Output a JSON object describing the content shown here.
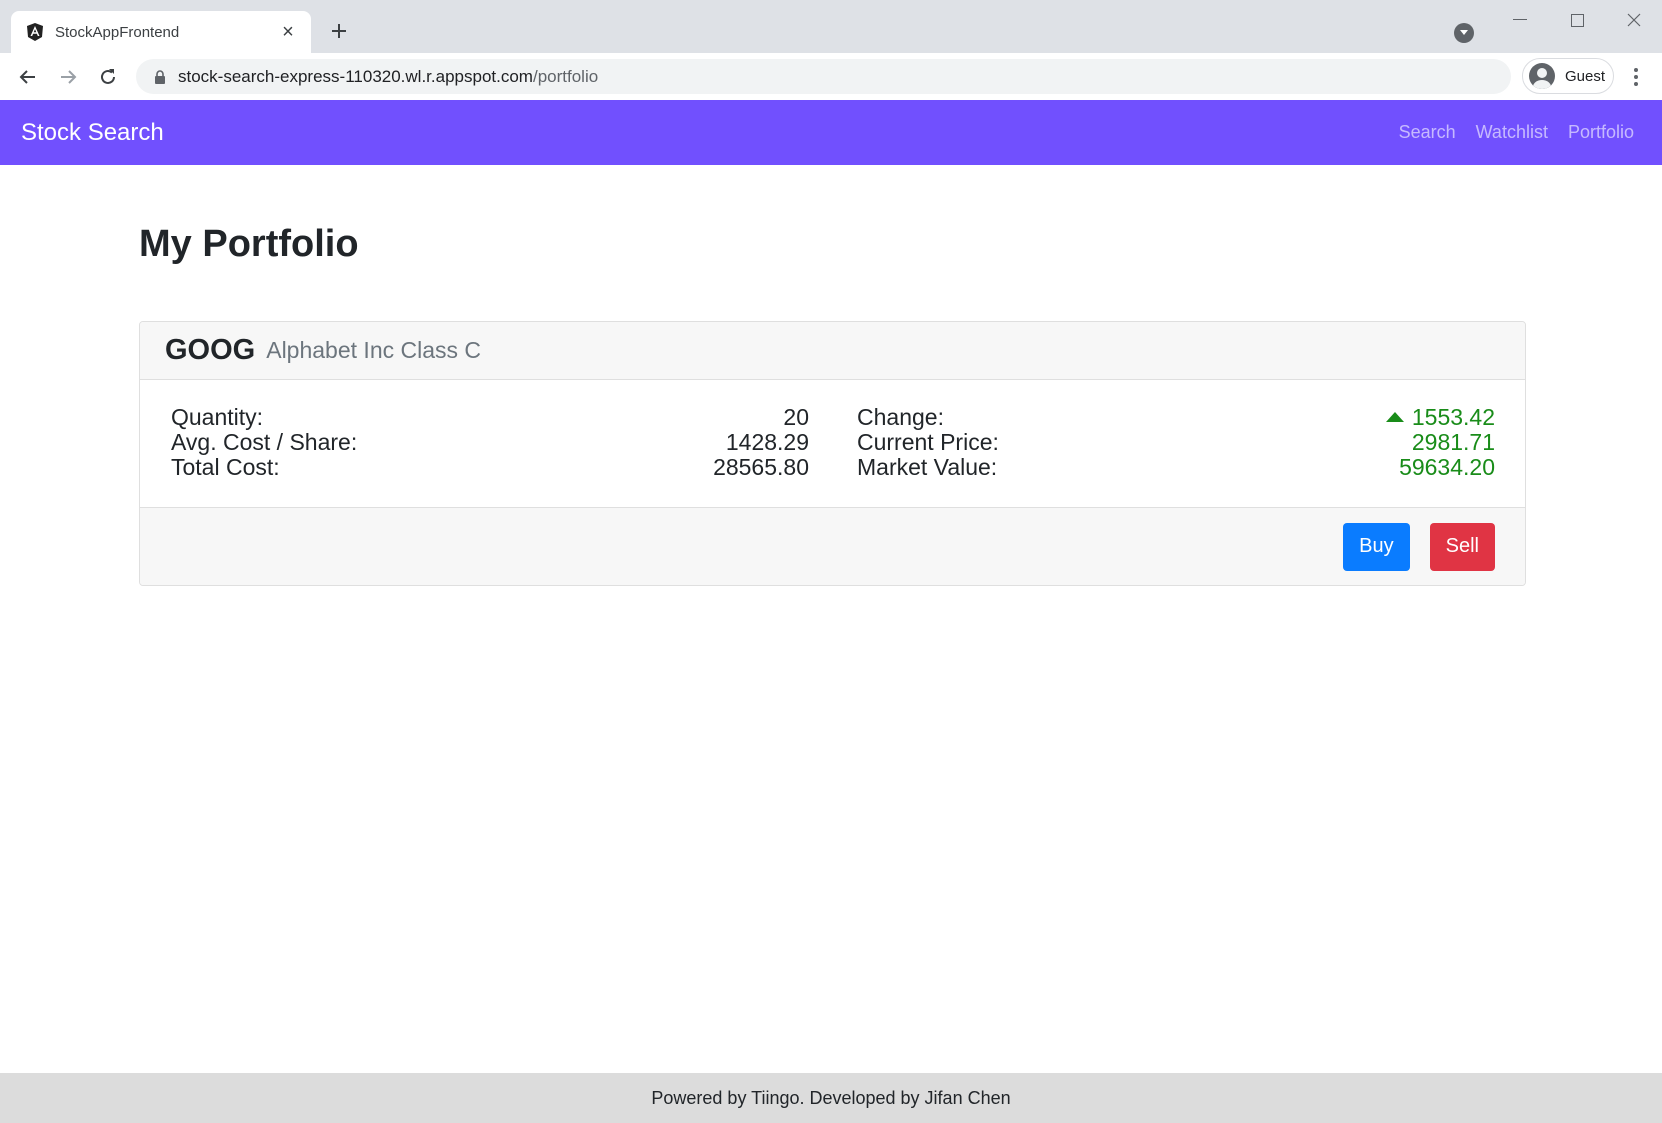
{
  "browser": {
    "tab_title": "StockAppFrontend",
    "url_host": "stock-search-express-110320.wl.r.appspot.com",
    "url_path": "/portfolio",
    "profile_label": "Guest"
  },
  "navbar": {
    "brand": "Stock Search",
    "links": [
      "Search",
      "Watchlist",
      "Portfolio"
    ]
  },
  "page": {
    "title": "My Portfolio"
  },
  "portfolio": [
    {
      "ticker": "GOOG",
      "company": "Alphabet Inc Class C",
      "left": [
        {
          "label": "Quantity:",
          "value": "20"
        },
        {
          "label": "Avg. Cost / Share:",
          "value": "1428.29"
        },
        {
          "label": "Total Cost:",
          "value": "28565.80"
        }
      ],
      "right": [
        {
          "label": "Change:",
          "value": "1553.42"
        },
        {
          "label": "Current Price:",
          "value": "2981.71"
        },
        {
          "label": "Market Value:",
          "value": "59634.20"
        }
      ],
      "change_direction": "up",
      "buy_label": "Buy",
      "sell_label": "Sell"
    }
  ],
  "footer": {
    "text": "Powered by Tiingo. Developed by Jifan Chen"
  },
  "colors": {
    "navbar": "#7150fe",
    "positive": "#198c19",
    "buy": "#0a7cff",
    "sell": "#e03444"
  }
}
